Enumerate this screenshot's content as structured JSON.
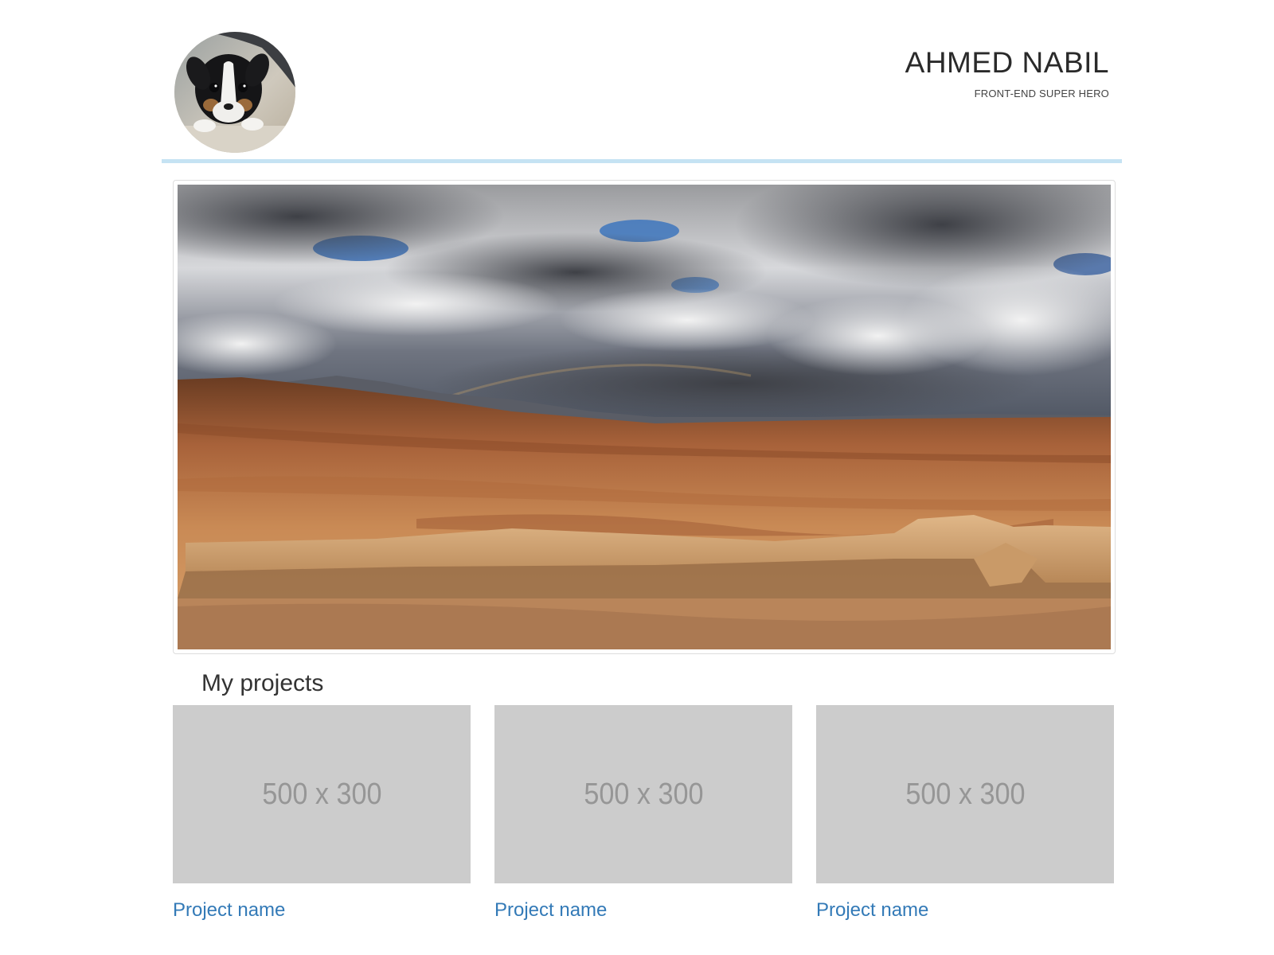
{
  "header": {
    "name": "AHMED NABIL",
    "tagline": "FRONT-END SUPER HERO",
    "avatar_icon": "puppy-photo"
  },
  "colors": {
    "header_rule": "#c5e3f3",
    "link": "#337ab7",
    "placeholder_bg": "#cccccc",
    "placeholder_text": "#969696"
  },
  "hero": {
    "image": "desert-landscape-stormy-sky"
  },
  "projects": {
    "title": "My projects",
    "items": [
      {
        "thumb_label": "500 x 300",
        "name": "Project name"
      },
      {
        "thumb_label": "500 x 300",
        "name": "Project name"
      },
      {
        "thumb_label": "500 x 300",
        "name": "Project name"
      }
    ]
  }
}
